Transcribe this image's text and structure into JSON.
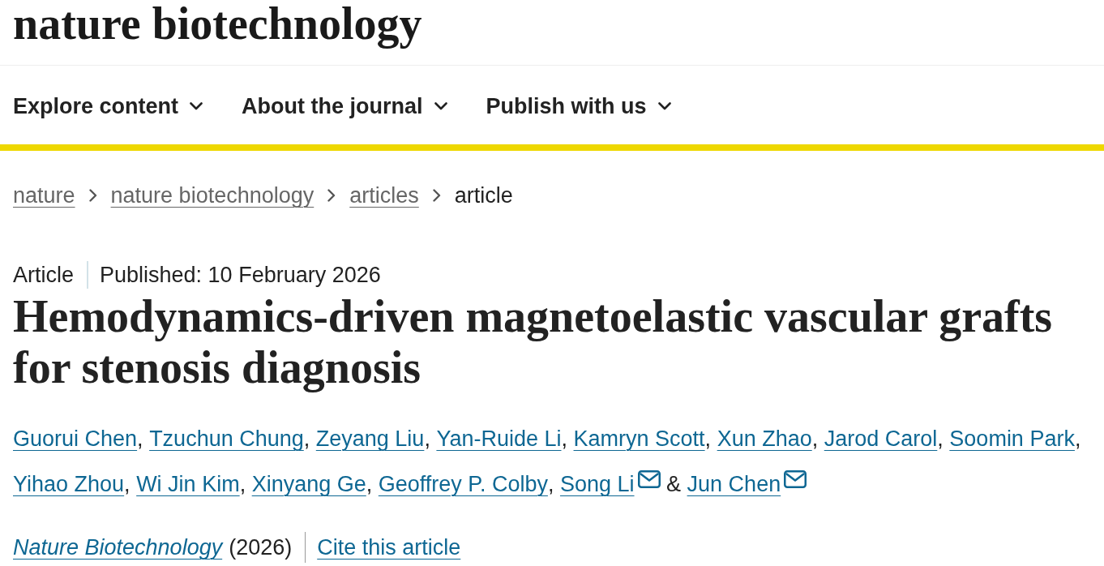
{
  "header": {
    "logo": "nature biotechnology"
  },
  "nav": {
    "items": [
      {
        "label": "Explore content"
      },
      {
        "label": "About the journal"
      },
      {
        "label": "Publish with us"
      }
    ]
  },
  "breadcrumb": [
    {
      "label": "nature",
      "kind": "link"
    },
    {
      "label": "nature biotechnology",
      "kind": "link"
    },
    {
      "label": "articles",
      "kind": "link"
    },
    {
      "label": "article",
      "kind": "current"
    }
  ],
  "article": {
    "type": "Article",
    "published": "Published: 10 February 2026",
    "title": "Hemodynamics-driven magnetoelastic vascular grafts for stenosis diagnosis",
    "authors": [
      {
        "name": "Guorui Chen",
        "separator": ",",
        "corresponding": false
      },
      {
        "name": "Tzuchun Chung",
        "separator": ",",
        "corresponding": false
      },
      {
        "name": "Zeyang Liu",
        "separator": ",",
        "corresponding": false
      },
      {
        "name": "Yan-Ruide Li",
        "separator": ",",
        "corresponding": false
      },
      {
        "name": "Kamryn Scott",
        "separator": ",",
        "corresponding": false
      },
      {
        "name": "Xun Zhao",
        "separator": ",",
        "corresponding": false
      },
      {
        "name": "Jarod Carol",
        "separator": ",",
        "corresponding": false
      },
      {
        "name": "Soomin Park",
        "separator": ",",
        "corresponding": false
      },
      {
        "name": "Yihao Zhou",
        "separator": ",",
        "corresponding": false
      },
      {
        "name": "Wi Jin Kim",
        "separator": ",",
        "corresponding": false
      },
      {
        "name": "Xinyang Ge",
        "separator": ",",
        "corresponding": false
      },
      {
        "name": "Geoffrey P. Colby",
        "separator": ",",
        "corresponding": false
      },
      {
        "name": "Song Li",
        "separator": "&",
        "corresponding": true
      },
      {
        "name": "Jun Chen",
        "corresponding": true
      }
    ],
    "journal": "Nature Biotechnology",
    "year": "(2026)",
    "cite_link": "Cite this article"
  }
}
